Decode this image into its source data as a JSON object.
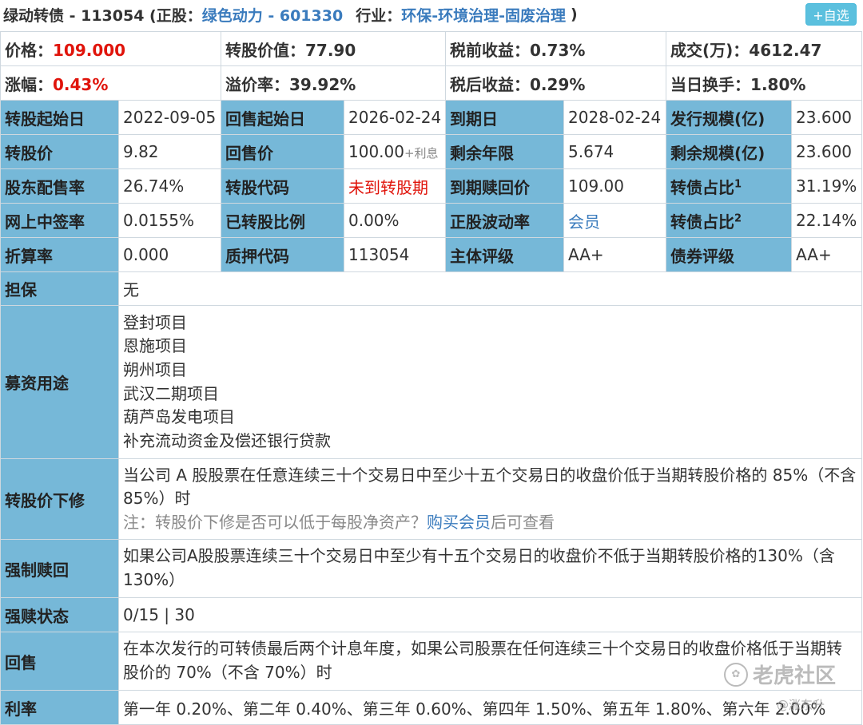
{
  "header": {
    "bond_title": "绿动转债 - 113054 (正股：",
    "stock_link": "绿色动力 - 601330",
    "industry_label": "行业：",
    "industry_link": "环保-环境治理-固废治理",
    "industry_close": ")",
    "favorite_button": "+自选"
  },
  "summary": {
    "price_label": "价格：",
    "price_value": "109.000",
    "conv_value": "转股价值：77.90",
    "pretax_yield": "税前收益：0.73%",
    "volume": "成交(万)：4612.47",
    "change_label": "涨幅：",
    "change_value": "0.43%",
    "premium": "溢价率：39.92%",
    "aftertax_yield": "税后收益：0.29%",
    "turnover": "当日换手：1.80%"
  },
  "grid": {
    "r1": [
      "转股起始日",
      "2022-09-05",
      "回售起始日",
      "2026-02-24",
      "到期日",
      "2028-02-24",
      "发行规模(亿)",
      "23.600"
    ],
    "r2": [
      "转股价",
      "9.82",
      "回售价",
      "100.00",
      "+利息",
      "剩余年限",
      "5.674",
      "剩余规模(亿)",
      "23.600"
    ],
    "r3": [
      "股东配售率",
      "26.74%",
      "转股代码",
      "未到转股期",
      "到期赎回价",
      "109.00",
      "转债占比",
      "1",
      "31.19%"
    ],
    "r4": [
      "网上中签率",
      "0.0155%",
      "已转股比例",
      "0.00%",
      "正股波动率",
      "会员",
      "转债占比",
      "2",
      "22.14%"
    ],
    "r5": [
      "折算率",
      "0.000",
      "质押代码",
      "113054",
      "主体评级",
      "AA+",
      "债券评级",
      "AA+"
    ]
  },
  "guarantee": {
    "label": "担保",
    "value": "无"
  },
  "fund_use": {
    "label": "募资用途",
    "items": [
      "登封项目",
      "恩施项目",
      "朔州项目",
      "武汉二期项目",
      "葫芦岛发电项目",
      "补充流动资金及偿还银行贷款"
    ]
  },
  "price_revision": {
    "label": "转股价下修",
    "text": "当公司 A 股股票在任意连续三十个交易日中至少十五个交易日的收盘价低于当期转股价格的 85%（不含 85%）时",
    "note_prefix": "注：转股价下修是否可以低于每股净资产？",
    "note_link": "购买会员",
    "note_suffix": "后可查看"
  },
  "forced_redeem": {
    "label": "强制赎回",
    "text": "如果公司A股股票连续三十个交易日中至少有十五个交易日的收盘价不低于当期转股价格的130%（含130%）"
  },
  "redeem_status": {
    "label": "强赎状态",
    "value": "0/15 | 30"
  },
  "put_back": {
    "label": "回售",
    "text": "在本次发行的可转债最后两个计息年度，如果公司股票在任何连续三十个交易日的收盘价格低于当期转股价的 70%（不含 70%）时"
  },
  "interest": {
    "label": "利率",
    "value": "第一年 0.20%、第二年 0.40%、第三年 0.60%、第四年 1.50%、第五年 1.80%、第六年 2.00%"
  },
  "watermark": {
    "brand": "老虎社区",
    "icon": "tiger-paw-icon",
    "user": "@涨东升"
  },
  "colors": {
    "label_bg": "#76b8d8",
    "link": "#3a7bbd",
    "red": "#e0140b",
    "button": "#5bc0de"
  }
}
